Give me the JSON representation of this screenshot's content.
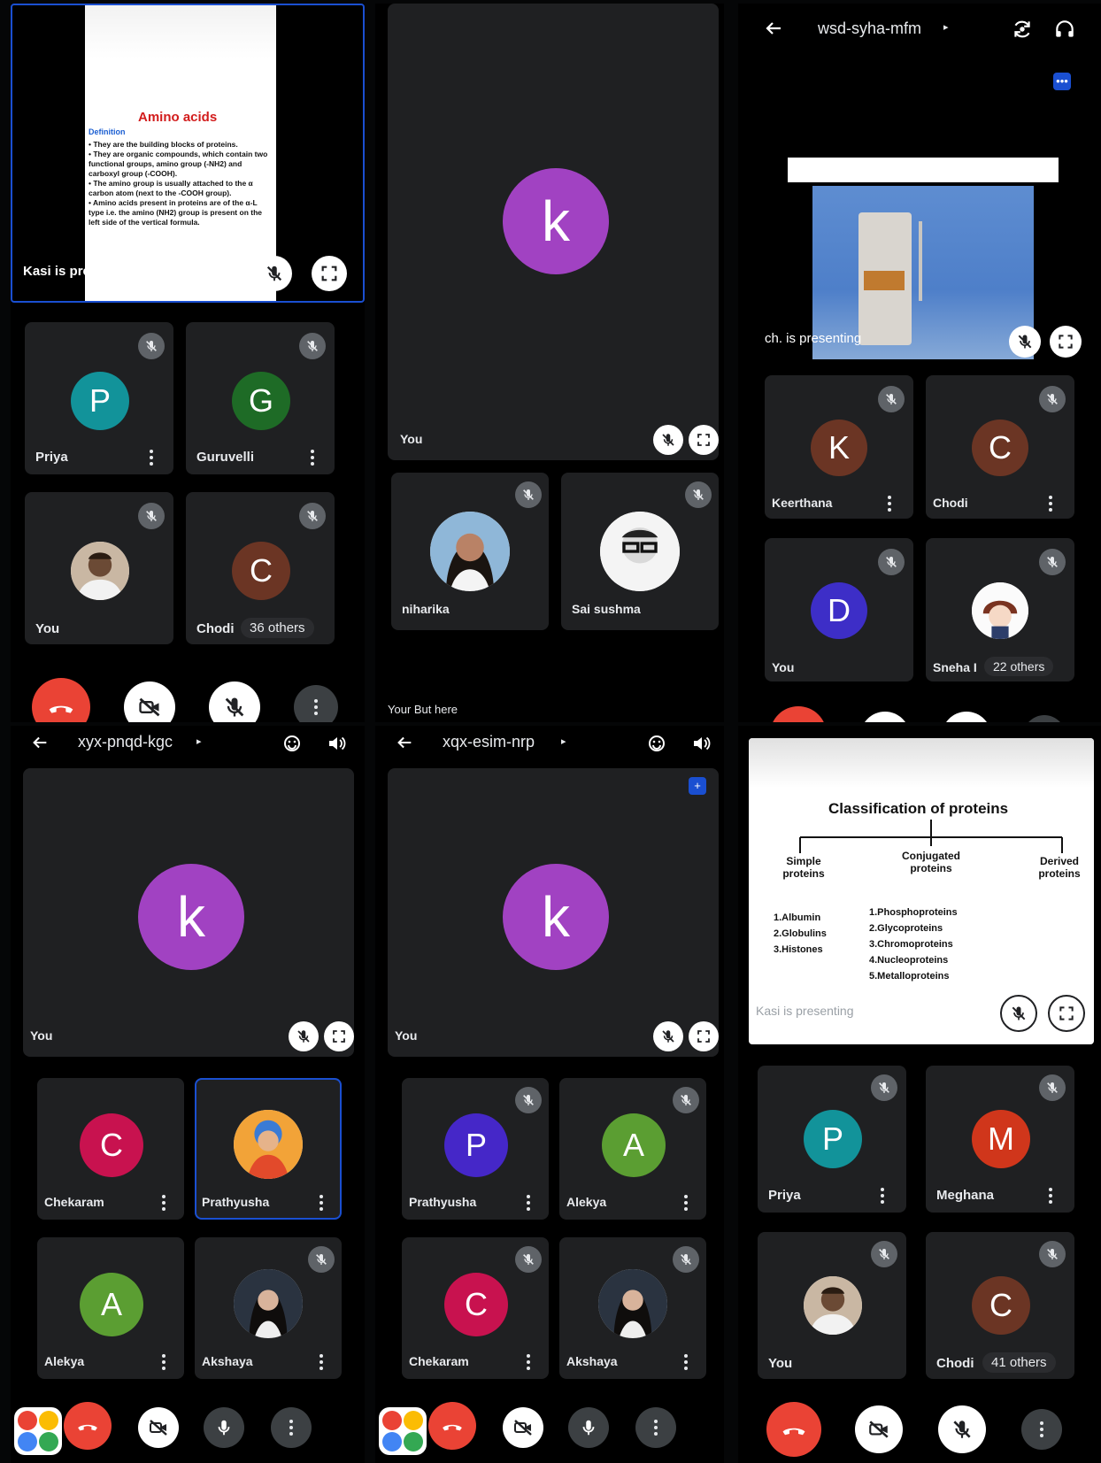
{
  "colors": {
    "end_call": "#ea4335",
    "avatar_k": "#a142c2",
    "avatar_p_teal": "#12939a",
    "avatar_g": "#1e6b26",
    "avatar_c_brown": "#6b3524",
    "avatar_k_brown": "#6b3524",
    "avatar_d": "#3d2ec7",
    "avatar_c_crimson": "#c8124f",
    "avatar_a_green": "#5b9e32",
    "avatar_p_indigo": "#4527c8",
    "avatar_m": "#d0361b",
    "highlight": "#1a4fd1"
  },
  "p1": {
    "slide": {
      "title": "Amino acids",
      "subtitle": "Definition",
      "bullets": [
        "• They are the building blocks of proteins.",
        "• They are organic compounds, which contain two functional groups, amino group (-NH2) and carboxyl group (-COOH).",
        "• The amino group is usually attached to the α carbon atom (next to the -COOH group).",
        "• Amino acids present in proteins are of the α-L type i.e. the amino (NH2) group is present on the left side of the vertical formula."
      ]
    },
    "presenting": "Kasi is presenting",
    "tiles": [
      {
        "name": "Priya",
        "initial": "P"
      },
      {
        "name": "Guruvelli",
        "initial": "G"
      },
      {
        "name": "You"
      },
      {
        "name": "Chodi",
        "initial": "C",
        "others": "36 others"
      }
    ]
  },
  "p2": {
    "main": {
      "initial": "k",
      "name": "You"
    },
    "tiles": [
      {
        "name": "niharika"
      },
      {
        "name": "Sai sushma"
      }
    ],
    "footer": "Your But here"
  },
  "p3": {
    "meeting_code": "wsd-syha-mfm",
    "presenting": "ch. is presenting",
    "tiles": [
      {
        "name": "Keerthana",
        "initial": "K"
      },
      {
        "name": "Chodi",
        "initial": "C"
      },
      {
        "name": "You",
        "initial": "D"
      },
      {
        "name": "Sneha I",
        "others": "22 others"
      }
    ]
  },
  "p4": {
    "meeting_code": "xyx-pnqd-kgc",
    "main": {
      "initial": "k",
      "name": "You"
    },
    "tiles": [
      {
        "name": "Chekaram",
        "initial": "C"
      },
      {
        "name": "Prathyusha"
      },
      {
        "name": "Alekya",
        "initial": "A"
      },
      {
        "name": "Akshaya"
      }
    ]
  },
  "p5": {
    "meeting_code": "xqx-esim-nrp",
    "main": {
      "initial": "k",
      "name": "You"
    },
    "tiles": [
      {
        "name": "Prathyusha",
        "initial": "P"
      },
      {
        "name": "Alekya",
        "initial": "A"
      },
      {
        "name": "Chekaram",
        "initial": "C"
      },
      {
        "name": "Akshaya"
      }
    ]
  },
  "p6": {
    "slide": {
      "title": "Classification of proteins",
      "col1": "Simple proteins",
      "col2": "Conjugated proteins",
      "col3": "Derived proteins",
      "list1": [
        "1.Albumin",
        "2.Globulins",
        "3.Histones"
      ],
      "list2": [
        "1.Phosphoproteins",
        "2.Glycoproteins",
        "3.Chromoproteins",
        "4.Nucleoproteins",
        "5.Metalloproteins"
      ]
    },
    "presenting": "Kasi is presenting",
    "tiles": [
      {
        "name": "Priya",
        "initial": "P"
      },
      {
        "name": "Meghana",
        "initial": "M"
      },
      {
        "name": "You"
      },
      {
        "name": "Chodi",
        "initial": "C",
        "others": "41 others"
      }
    ]
  }
}
